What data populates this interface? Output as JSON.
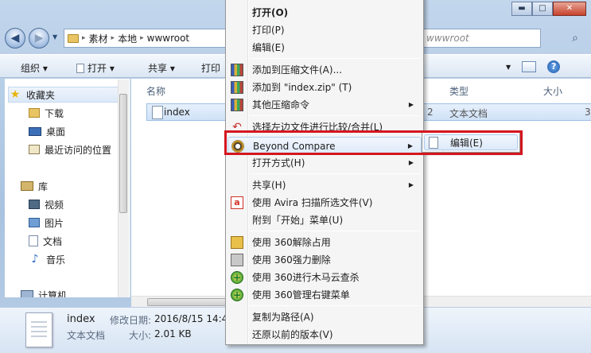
{
  "window": {
    "minimize_label": "▬",
    "maximize_label": "□",
    "close_label": "✕"
  },
  "address": {
    "crumbs": [
      "素材",
      "本地",
      "wwwroot"
    ],
    "ghost_text": "wwwroot"
  },
  "toolbar": {
    "organize": "组织 ▾",
    "open": "打开 ▾",
    "share": "共享 ▾",
    "print": "打印"
  },
  "sidebar": {
    "favorites": "收藏夹",
    "downloads": "下载",
    "desktop": "桌面",
    "recent": "最近访问的位置",
    "libraries": "库",
    "videos": "视频",
    "pictures": "图片",
    "documents": "文档",
    "music": "音乐",
    "computer": "计算机"
  },
  "columns": {
    "name": "名称",
    "type": "类型",
    "size": "大小"
  },
  "file": {
    "name": "index",
    "date_frag": "2",
    "type": "文本文档",
    "size_frag": "3"
  },
  "details": {
    "name": "index",
    "modified_label": "修改日期:",
    "modified_value": "2016/8/15 14:4",
    "type": "文本文档",
    "size_label": "大小:",
    "size_value": "2.01 KB"
  },
  "context_menu": {
    "open": "打开(O)",
    "print": "打印(P)",
    "edit": "编辑(E)",
    "add_archive": "添加到压缩文件(A)...",
    "add_zip": "添加到 \"index.zip\" (T)",
    "other_compress": "其他压缩命令",
    "select_left": "选择左边文件进行比较/合并(L)",
    "beyond_compare": "Beyond Compare",
    "open_with": "打开方式(H)",
    "share": "共享(H)",
    "avira": "使用 Avira 扫描所选文件(V)",
    "pin_start": "附到「开始」菜单(U)",
    "unlock360": "使用 360解除占用",
    "force_delete360": "使用 360强力删除",
    "trojan360": "使用 360进行木马云查杀",
    "manage360": "使用 360管理右键菜单",
    "copy_path": "复制为路径(A)",
    "restore": "还原以前的版本(V)"
  },
  "submenu": {
    "edit": "编辑(E)"
  },
  "colors": {
    "highlight_box": "#d4161e"
  }
}
